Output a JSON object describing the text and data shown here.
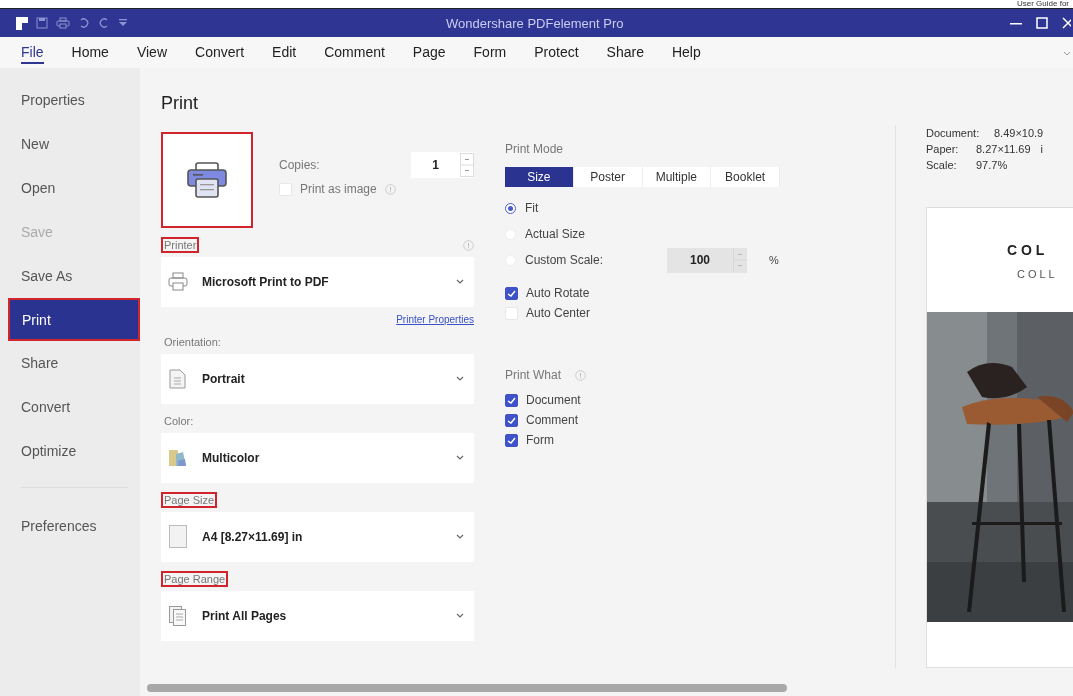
{
  "doc_header": {
    "text": "User Guide for"
  },
  "window": {
    "title": "Wondershare PDFelement Pro"
  },
  "menu": [
    {
      "label": "File",
      "selected": true
    },
    {
      "label": "Home",
      "selected": false
    },
    {
      "label": "View",
      "selected": false
    },
    {
      "label": "Convert",
      "selected": false
    },
    {
      "label": "Edit",
      "selected": false
    },
    {
      "label": "Comment",
      "selected": false
    },
    {
      "label": "Page",
      "selected": false
    },
    {
      "label": "Form",
      "selected": false
    },
    {
      "label": "Protect",
      "selected": false
    },
    {
      "label": "Share",
      "selected": false
    },
    {
      "label": "Help",
      "selected": false
    }
  ],
  "sidebar": {
    "items": [
      {
        "label": "Properties",
        "selected": false,
        "disabled": false
      },
      {
        "label": "New",
        "selected": false,
        "disabled": false
      },
      {
        "label": "Open",
        "selected": false,
        "disabled": false
      },
      {
        "label": "Save",
        "selected": false,
        "disabled": true
      },
      {
        "label": "Save As",
        "selected": false,
        "disabled": false
      },
      {
        "label": "Print",
        "selected": true,
        "disabled": false
      },
      {
        "label": "Share",
        "selected": false,
        "disabled": false
      },
      {
        "label": "Convert",
        "selected": false,
        "disabled": false
      },
      {
        "label": "Optimize",
        "selected": false,
        "disabled": false
      }
    ],
    "footer_items": [
      {
        "label": "Preferences",
        "selected": false
      }
    ]
  },
  "print": {
    "title": "Print",
    "printer_box": {
      "highlighted": true
    },
    "copies": {
      "label": "Copies:",
      "value": "1"
    },
    "print_as_image": {
      "label": "Print as image",
      "checked": false
    },
    "fields": [
      {
        "label": "Printer",
        "highlighted": true,
        "info": true,
        "kind": "printer",
        "value": "Microsoft Print to PDF",
        "link": "Printer Properties"
      },
      {
        "label": "Orientation:",
        "highlighted": false,
        "info": false,
        "kind": "page",
        "value": "Portrait"
      },
      {
        "label": "Color:",
        "highlighted": false,
        "info": false,
        "kind": "color",
        "value": "Multicolor"
      },
      {
        "label": "Page Size",
        "highlighted": true,
        "info": false,
        "kind": "blank",
        "value": "A4 [8.27×11.69] in"
      },
      {
        "label": "Page Range",
        "highlighted": true,
        "info": false,
        "kind": "pages",
        "value": "Print All Pages"
      }
    ],
    "print_mode": {
      "label": "Print Mode",
      "tabs": [
        {
          "label": "Size",
          "selected": true
        },
        {
          "label": "Poster",
          "selected": false
        },
        {
          "label": "Multiple",
          "selected": false
        },
        {
          "label": "Booklet",
          "selected": false
        }
      ],
      "scale_options": [
        {
          "label": "Fit",
          "selected": true
        },
        {
          "label": "Actual Size",
          "selected": false
        },
        {
          "label": "Custom Scale:",
          "selected": false
        }
      ],
      "custom_scale": {
        "value": "100",
        "unit": "%"
      },
      "options": [
        {
          "label": "Auto Rotate",
          "checked": true
        },
        {
          "label": "Auto Center",
          "checked": false
        }
      ]
    },
    "print_what": {
      "label": "Print What",
      "items": [
        {
          "label": "Document",
          "checked": true
        },
        {
          "label": "Comment",
          "checked": true
        },
        {
          "label": "Form",
          "checked": true
        }
      ]
    },
    "preview": {
      "info": [
        {
          "label": "Document:",
          "value": "8.49×10.9"
        },
        {
          "label": "Paper:",
          "value": "8.27×11.69",
          "unit": "i"
        },
        {
          "label": "Scale:",
          "value": "97.7%"
        }
      ],
      "page_lines": [
        "C O L",
        "C O L L"
      ],
      "photo": {
        "kind": "picture"
      }
    }
  }
}
